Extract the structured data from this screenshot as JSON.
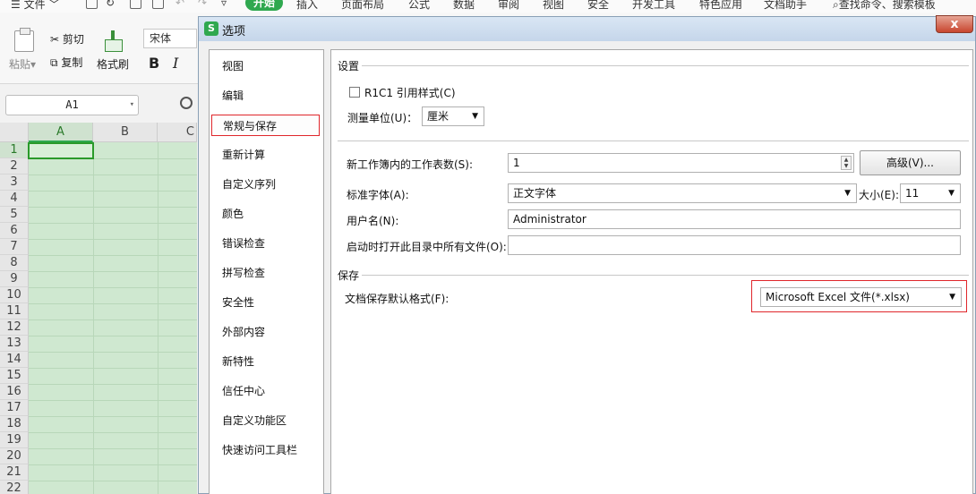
{
  "menubar": {
    "file": "文件",
    "tabs": [
      "开始",
      "插入",
      "页面布局",
      "公式",
      "数据",
      "审阅",
      "视图",
      "安全",
      "开发工具",
      "特色应用",
      "文档助手"
    ],
    "search": "查找命令、搜索模板"
  },
  "ribbon": {
    "paste": "粘贴",
    "cut": "剪切",
    "copy": "复制",
    "format_painter": "格式刷",
    "font": "宋体",
    "bold": "B",
    "italic": "I"
  },
  "namebox": {
    "value": "A1"
  },
  "sheet": {
    "columns": [
      "A",
      "B",
      "C"
    ],
    "rows": [
      "1",
      "2",
      "3",
      "4",
      "5",
      "6",
      "7",
      "8",
      "9",
      "10",
      "11",
      "12",
      "13",
      "14",
      "15",
      "16",
      "17",
      "18",
      "19",
      "20",
      "21",
      "22"
    ]
  },
  "dialog": {
    "title": "选项",
    "close": "x",
    "nav": [
      "视图",
      "编辑",
      "常规与保存",
      "重新计算",
      "自定义序列",
      "颜色",
      "错误检查",
      "拼写检查",
      "安全性",
      "外部内容",
      "新特性",
      "信任中心",
      "自定义功能区",
      "快速访问工具栏"
    ],
    "selected_nav": "常规与保存",
    "settings": {
      "section": "设置",
      "r1c1_label": "R1C1 引用样式(C)",
      "r1c1_checked": false,
      "unit_label": "测量单位(U)：",
      "unit_value": "厘米",
      "sheets_label": "新工作簿内的工作表数(S):",
      "sheets_value": "1",
      "advanced_button": "高级(V)...",
      "font_label": "标准字体(A):",
      "font_value": "正文字体",
      "size_label": "大小(E):",
      "size_value": "11",
      "username_label": "用户名(N):",
      "username_value": "Administrator",
      "startup_label": "启动时打开此目录中所有文件(O):",
      "startup_value": ""
    },
    "save": {
      "section": "保存",
      "format_label": "文档保存默认格式(F):",
      "format_value": "Microsoft Excel 文件(*.xlsx)"
    }
  },
  "colors": {
    "accent_green": "#2fa84f",
    "highlight_red": "#e0262b"
  }
}
